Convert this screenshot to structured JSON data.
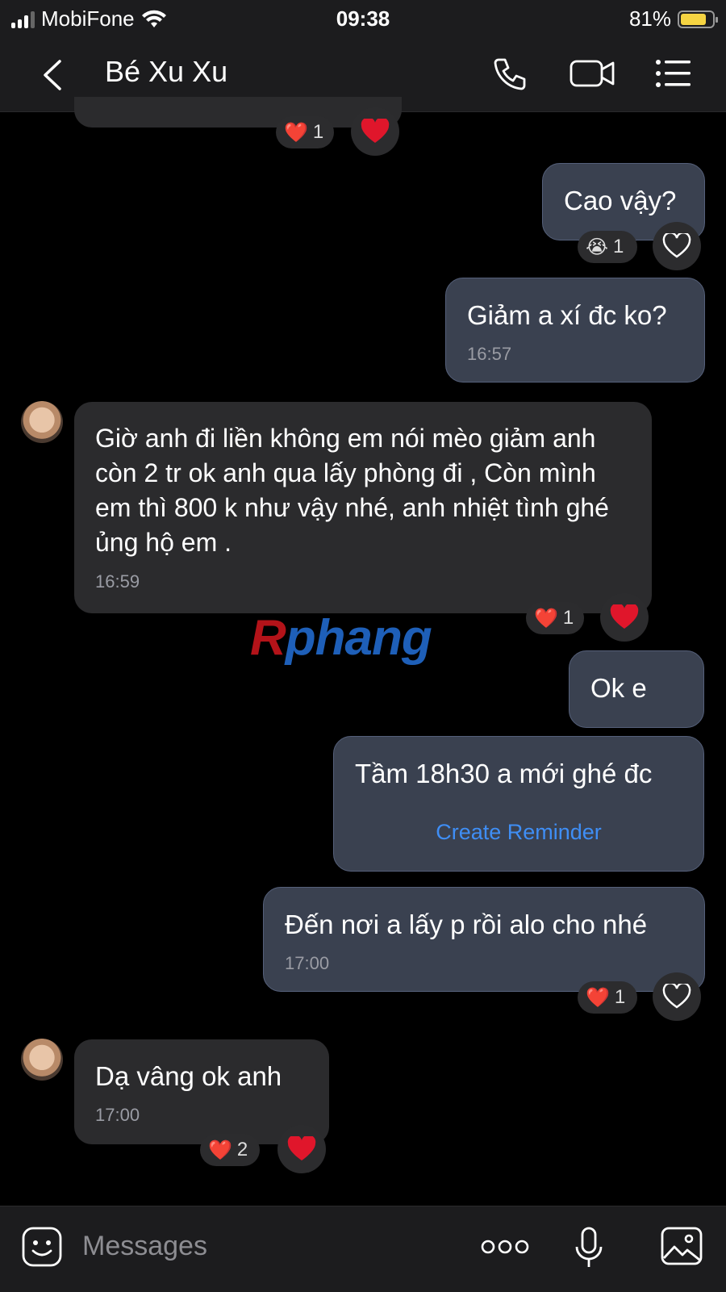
{
  "status_bar": {
    "carrier": "MobiFone",
    "time": "09:38",
    "battery": "81%",
    "battery_level": 0.81
  },
  "header": {
    "title": "Bé Xu Xu"
  },
  "messages": [
    {
      "dir": "out",
      "text": "Cao vậy?",
      "reaction_emoji": "😭",
      "reaction_count": "1"
    },
    {
      "dir": "out",
      "text": "Giảm a xí đc ko?",
      "time": "16:57"
    },
    {
      "dir": "in",
      "text": "Giờ anh đi liền không em nói mèo giảm anh còn 2 tr ok anh qua lấy phòng đi , Còn mình em thì 800 k như vậy nhé, anh nhiệt tình ghé ủng hộ em .",
      "time": "16:59",
      "reaction_emoji": "❤️",
      "reaction_count": "1"
    },
    {
      "dir": "out",
      "text": "Ok e"
    },
    {
      "dir": "out",
      "text": "Tầm 18h30 a mới ghé đc",
      "action": "Create Reminder"
    },
    {
      "dir": "out",
      "text": "Đến nơi a lấy p rồi alo cho nhé",
      "time": "17:00",
      "reaction_emoji": "❤️",
      "reaction_count": "1"
    },
    {
      "dir": "in",
      "text": "Dạ vâng ok anh",
      "time": "17:00",
      "reaction_emoji": "❤️",
      "reaction_count": "2"
    }
  ],
  "top_partial_reaction": {
    "emoji": "❤️",
    "count": "1"
  },
  "watermark": {
    "part1": "R",
    "part2": "phang"
  },
  "composer": {
    "placeholder": "Messages"
  },
  "colors": {
    "accent_link": "#3f8ef5",
    "heart": "#e0162b",
    "outgoing_bubble": "#3a4150",
    "incoming_bubble": "#2b2b2d"
  }
}
